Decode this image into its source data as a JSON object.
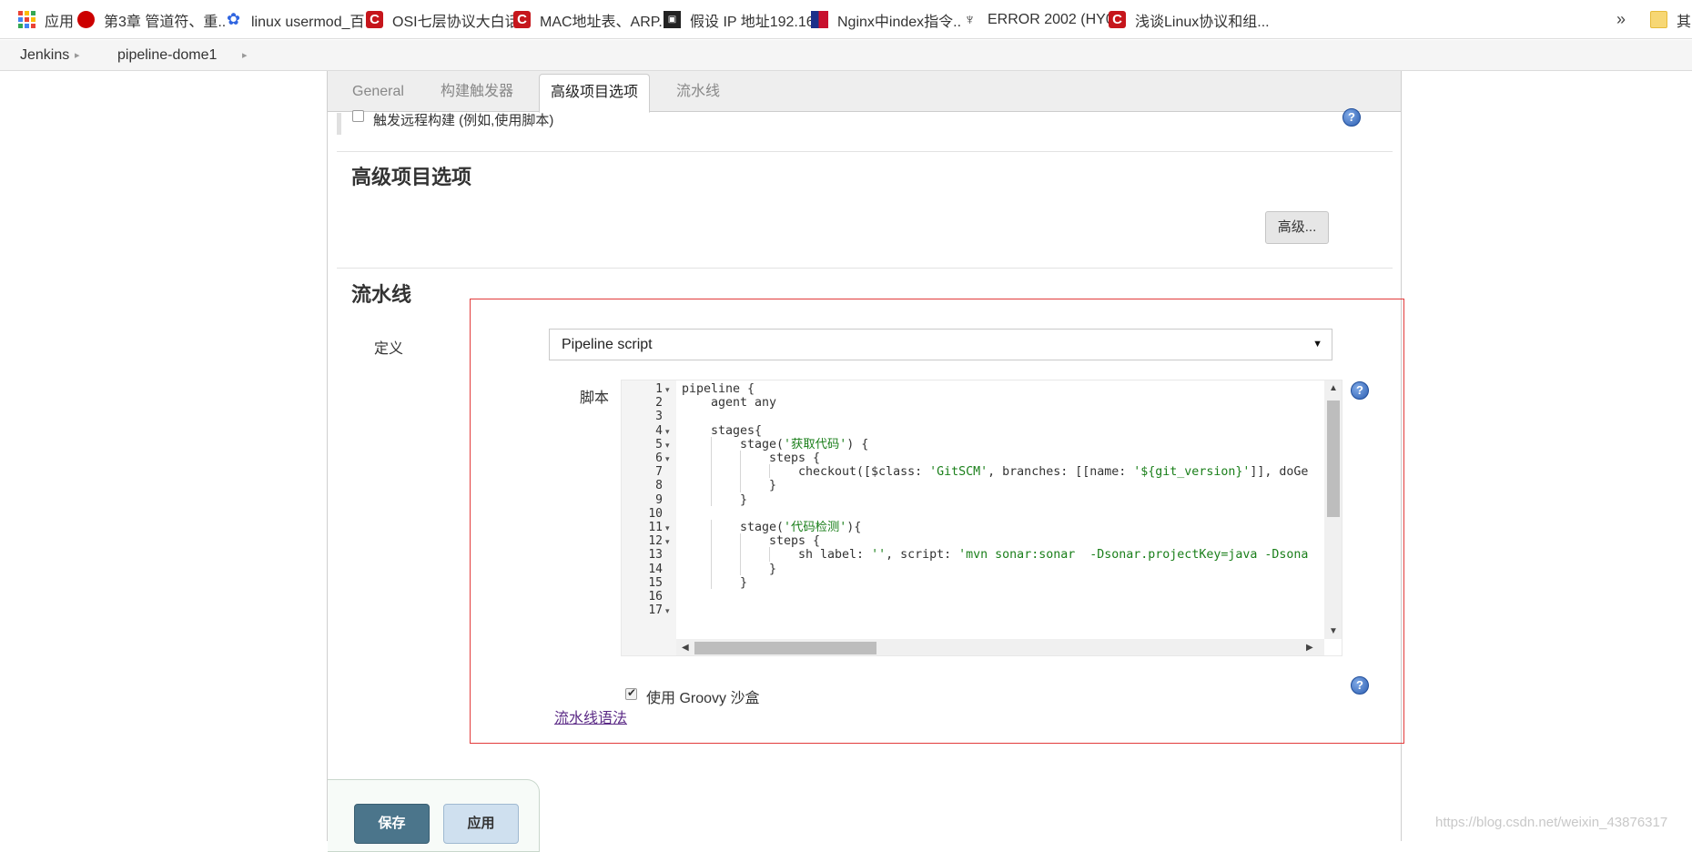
{
  "bookmarks": [
    {
      "label": "应用",
      "icon": "apps-icon"
    },
    {
      "label": "第3章 管道符、重...",
      "icon": "redhat-icon"
    },
    {
      "label": "linux usermod_百...",
      "icon": "baidu-paw-icon"
    },
    {
      "label": "OSI七层协议大白话...",
      "icon": "csdn-icon"
    },
    {
      "label": "MAC地址表、ARP...",
      "icon": "csdn-icon"
    },
    {
      "label": "假设 IP 地址192.16...",
      "icon": "site-icon"
    },
    {
      "label": "Nginx中index指令...",
      "icon": "flag-icon"
    },
    {
      "label": "ERROR 2002 (HY0...",
      "icon": "mysql-icon"
    },
    {
      "label": "浅谈Linux协议和组...",
      "icon": "csdn-icon"
    }
  ],
  "bookmarks_overflow": "»",
  "bookmarks_folder": "其",
  "breadcrumb": {
    "items": [
      "Jenkins",
      "pipeline-dome1"
    ],
    "sep": "▸"
  },
  "tabs": [
    {
      "label": "General",
      "active": false
    },
    {
      "label": "构建触发器",
      "active": false
    },
    {
      "label": "高级项目选项",
      "active": true
    },
    {
      "label": "流水线",
      "active": false
    }
  ],
  "trigger": {
    "label": "触发远程构建 (例如,使用脚本)",
    "checked": false
  },
  "advanced": {
    "title": "高级项目选项",
    "button": "高级..."
  },
  "pipeline": {
    "title": "流水线",
    "definition_label": "定义",
    "definition_value": "Pipeline script",
    "script_label": "脚本",
    "groovy_label": "使用 Groovy 沙盒",
    "groovy_checked": true,
    "syntax_link": "流水线语法"
  },
  "code_lines": [
    {
      "n": "1",
      "fold": true,
      "indent": 0,
      "parts": [
        {
          "t": "pipeline {",
          "s": false
        }
      ]
    },
    {
      "n": "2",
      "fold": false,
      "indent": 1,
      "parts": [
        {
          "t": "agent any",
          "s": false
        }
      ]
    },
    {
      "n": "3",
      "fold": false,
      "indent": 0,
      "parts": []
    },
    {
      "n": "4",
      "fold": true,
      "indent": 1,
      "parts": [
        {
          "t": "stages{",
          "s": false
        }
      ]
    },
    {
      "n": "5",
      "fold": true,
      "indent": 2,
      "parts": [
        {
          "t": "stage(",
          "s": false
        },
        {
          "t": "'获取代码'",
          "s": true
        },
        {
          "t": ") {",
          "s": false
        }
      ]
    },
    {
      "n": "6",
      "fold": true,
      "indent": 3,
      "parts": [
        {
          "t": "steps {",
          "s": false
        }
      ]
    },
    {
      "n": "7",
      "fold": false,
      "indent": 4,
      "parts": [
        {
          "t": "checkout([$class: ",
          "s": false
        },
        {
          "t": "'GitSCM'",
          "s": true
        },
        {
          "t": ", branches: [[name: ",
          "s": false
        },
        {
          "t": "'${git_version}'",
          "s": true
        },
        {
          "t": "]], doGe",
          "s": false
        }
      ]
    },
    {
      "n": "8",
      "fold": false,
      "indent": 3,
      "parts": [
        {
          "t": "}",
          "s": false
        }
      ]
    },
    {
      "n": "9",
      "fold": false,
      "indent": 2,
      "parts": [
        {
          "t": "}",
          "s": false
        }
      ]
    },
    {
      "n": "10",
      "fold": false,
      "indent": 0,
      "parts": []
    },
    {
      "n": "11",
      "fold": true,
      "indent": 2,
      "parts": [
        {
          "t": "stage(",
          "s": false
        },
        {
          "t": "'代码检测'",
          "s": true
        },
        {
          "t": "){",
          "s": false
        }
      ]
    },
    {
      "n": "12",
      "fold": true,
      "indent": 3,
      "parts": [
        {
          "t": "steps {",
          "s": false
        }
      ]
    },
    {
      "n": "13",
      "fold": false,
      "indent": 4,
      "parts": [
        {
          "t": "sh label: ",
          "s": false
        },
        {
          "t": "''",
          "s": true
        },
        {
          "t": ", script: ",
          "s": false
        },
        {
          "t": "'mvn sonar:sonar  -Dsonar.projectKey=java -Dsona",
          "s": true
        }
      ]
    },
    {
      "n": "14",
      "fold": false,
      "indent": 3,
      "parts": [
        {
          "t": "}",
          "s": false
        }
      ]
    },
    {
      "n": "15",
      "fold": false,
      "indent": 2,
      "parts": [
        {
          "t": "}",
          "s": false
        }
      ]
    },
    {
      "n": "16",
      "fold": false,
      "indent": 0,
      "parts": []
    },
    {
      "n": "17",
      "fold": true,
      "indent": 0,
      "parts": []
    }
  ],
  "buttons": {
    "save": "保存",
    "apply": "应用"
  },
  "watermark": "https://blog.csdn.net/weixin_43876317",
  "colors": {
    "accent": "#4b758b",
    "error_border": "#e23b3b",
    "link": "#5b2a86",
    "string": "#1a7f1a"
  }
}
